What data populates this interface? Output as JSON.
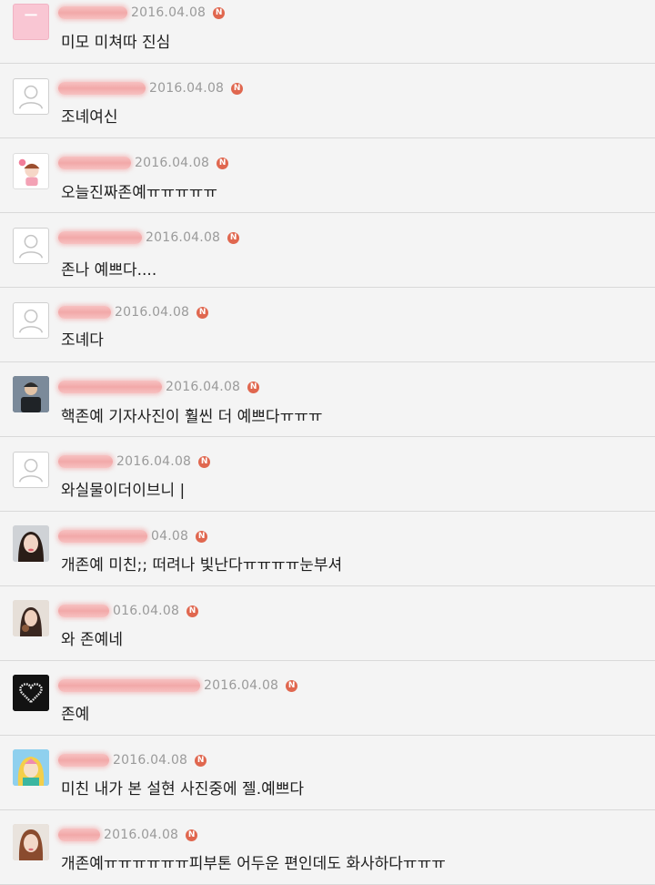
{
  "comments": [
    {
      "date": "2016.04.08",
      "badge": "N",
      "text": "미모 미쳐따 진심",
      "avatar": "pink-square-icon"
    },
    {
      "date": "2016.04.08",
      "badge": "N",
      "text": "조녜여신",
      "avatar": "default-user-icon"
    },
    {
      "date": "2016.04.08",
      "badge": "N",
      "text": "오늘진짜존예ㅠㅠㅠㅠㅠ",
      "avatar": "cartoon-avatar-icon"
    },
    {
      "date": "2016.04.08",
      "badge": "N",
      "text": "존나 예쁘다....",
      "avatar": "default-user-icon"
    },
    {
      "date": "2016.04.08",
      "badge": "N",
      "text": "조녜다",
      "avatar": "default-user-icon"
    },
    {
      "date": "2016.04.08",
      "badge": "N",
      "text": "핵존예 기자사진이 훨씬 더 예쁘다ㅠㅠㅠ",
      "avatar": "photo-avatar-icon"
    },
    {
      "date": "2016.04.08",
      "badge": "N",
      "text": "와실물이더이브니 |",
      "avatar": "default-user-icon"
    },
    {
      "date": "04.08",
      "badge": "N",
      "text": "개존예 미친;; 떠려나 빛난다ㅠㅠㅠㅠ눈부셔",
      "avatar": "photo-avatar-icon"
    },
    {
      "date": "016.04.08",
      "badge": "N",
      "text": "와 존예네",
      "avatar": "photo-avatar-icon"
    },
    {
      "date": "2016.04.08",
      "badge": "N",
      "text": "존예",
      "avatar": "heart-logo-icon"
    },
    {
      "date": "2016.04.08",
      "badge": "N",
      "text": "미친 내가 본 설현 사진중에 젤.예쁘다",
      "avatar": "cartoon-avatar-icon"
    },
    {
      "date": "2016.04.08",
      "badge": "N",
      "text": "개존예ㅠㅠㅠㅠㅠㅠ피부톤 어두운 편인데도 화사하다ㅠㅠㅠ",
      "avatar": "photo-avatar-icon"
    }
  ],
  "colors": {
    "background": "#f4f4f4",
    "divider": "#d9d9d9",
    "badge": "#e0674f",
    "redaction": "#f2a8a8"
  }
}
